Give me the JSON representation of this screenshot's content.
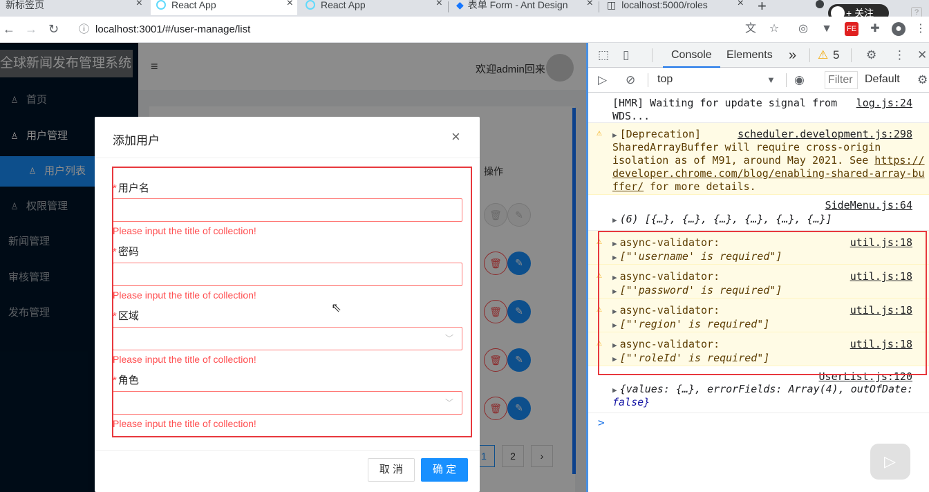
{
  "browser": {
    "tabs": [
      {
        "title": "新标签页"
      },
      {
        "title": "React App"
      },
      {
        "title": "React App"
      },
      {
        "title": "表单 Form - Ant Design"
      },
      {
        "title": "localhost:5000/roles"
      }
    ],
    "new_tab": "+",
    "follow_button": "+ 关注",
    "url": "localhost:3001/#/user-manage/list"
  },
  "app": {
    "title": "全球新闻发布管理系统",
    "menu": [
      {
        "label": "首页",
        "icon": "user-icon"
      },
      {
        "label": "用户管理",
        "icon": "user-icon"
      },
      {
        "label": "用户列表",
        "icon": "user-icon"
      },
      {
        "label": "权限管理",
        "icon": "user-icon"
      },
      {
        "label": "新闻管理"
      },
      {
        "label": "审核管理"
      },
      {
        "label": "发布管理"
      }
    ],
    "header": {
      "welcome": "欢迎admin回来"
    },
    "table": {
      "col_action": "操作"
    },
    "pagination": {
      "page1": "1",
      "page2": "2",
      "next": "›"
    }
  },
  "modal": {
    "title": "添加用户",
    "close": "×",
    "fields": [
      {
        "label": "用户名",
        "required": "*",
        "error": "Please input the title of collection!"
      },
      {
        "label": "密码",
        "required": "*",
        "error": "Please input the title of collection!"
      },
      {
        "label": "区域",
        "required": "*",
        "error": "Please input the title of collection!"
      },
      {
        "label": "角色",
        "required": "*",
        "error": "Please input the title of collection!"
      }
    ],
    "cancel": "取 消",
    "ok": "确 定"
  },
  "devtools": {
    "tabs": {
      "console": "Console",
      "elements": "Elements",
      "more": "»"
    },
    "warnings_count": "5",
    "context": "top",
    "filter_placeholder": "Filter",
    "levels": "Default",
    "messages": [
      {
        "text1": "[HMR] Waiting for update signal from",
        "text2": "WDS...",
        "source": "log.js:24"
      },
      {
        "text1": "[Deprecation]",
        "text2": "SharedArrayBuffer will require cross-origin",
        "text3": "isolation as of M91, around May 2021. See",
        "link1": "https://",
        "link2": "developer.chrome.com/blog/enabling-shared-array-bu",
        "link3": "ffer/",
        "text4": " for more details.",
        "source": "scheduler.development.js:298"
      },
      {
        "text1": "(6) [{…}, {…}, {…}, {…}, {…}, {…}]",
        "source": "SideMenu.js:64"
      },
      {
        "text1": "async-validator:",
        "text2": "[\"'username' is required\"]",
        "source": "util.js:18"
      },
      {
        "text1": "async-validator:",
        "text2": "[\"'password' is required\"]",
        "source": "util.js:18"
      },
      {
        "text1": "async-validator:",
        "text2": "[\"'region' is required\"]",
        "source": "util.js:18"
      },
      {
        "text1": "async-validator:",
        "text2": "[\"'roleId' is required\"]",
        "source": "util.js:18"
      },
      {
        "text1": "{values: {…}, errorFields: Array(4), outOfDate:",
        "text2": "false}",
        "source": "UserList.js:120"
      }
    ],
    "prompt": ">"
  }
}
